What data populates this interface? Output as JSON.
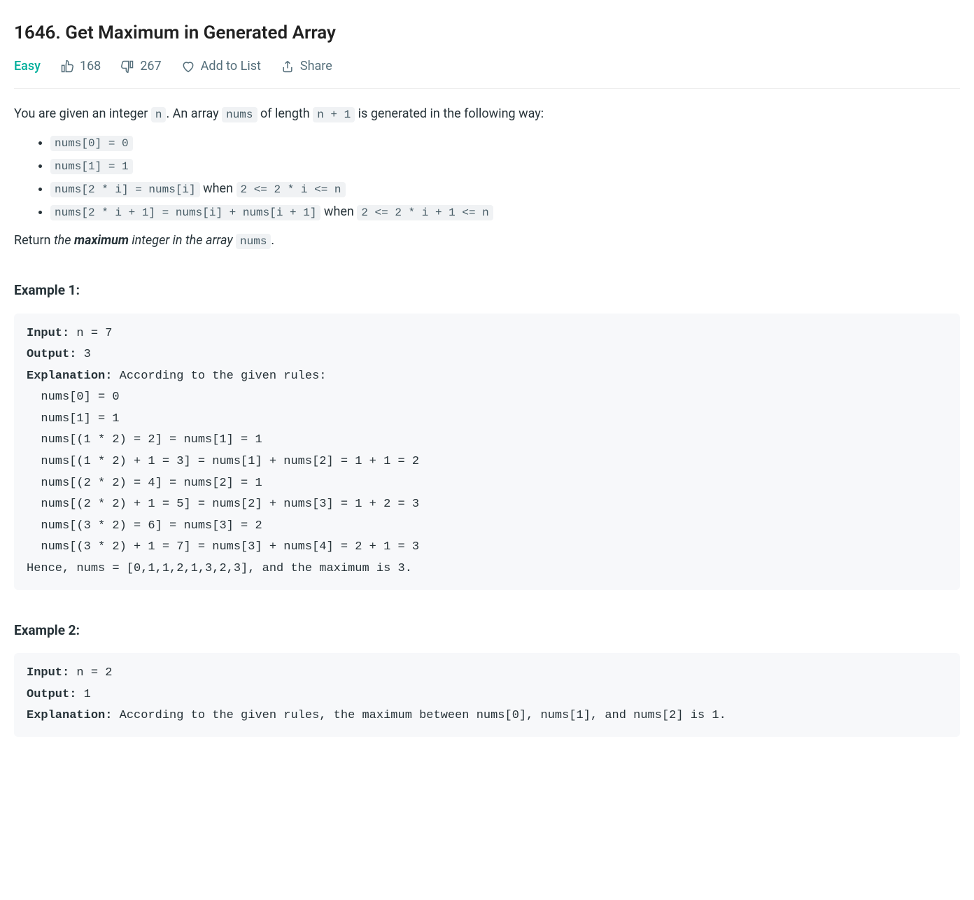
{
  "title": "1646. Get Maximum in Generated Array",
  "meta": {
    "difficulty": "Easy",
    "likes": "168",
    "dislikes": "267",
    "add_to_list": "Add to List",
    "share": "Share"
  },
  "intro": {
    "p1_prefix": "You are given an integer ",
    "p1_code1": "n",
    "p1_mid1": ". An array ",
    "p1_code2": "nums",
    "p1_mid2": " of length ",
    "p1_code3": "n + 1",
    "p1_suffix": " is generated in the following way:"
  },
  "rules": [
    {
      "code_a": "nums[0] = 0",
      "plain_a": "",
      "code_b": "",
      "plain_b": ""
    },
    {
      "code_a": "nums[1] = 1",
      "plain_a": "",
      "code_b": "",
      "plain_b": ""
    },
    {
      "code_a": "nums[2 * i] = nums[i]",
      "plain_a": " when ",
      "code_b": "2 <= 2 * i <= n",
      "plain_b": ""
    },
    {
      "code_a": "nums[2 * i + 1] = nums[i] + nums[i + 1]",
      "plain_a": " when ",
      "code_b": "2 <= 2 * i + 1 <= n",
      "plain_b": ""
    }
  ],
  "return": {
    "prefix": "Return ",
    "em_prefix": "the ",
    "strong": "maximum",
    "em_suffix": " integer in the array ",
    "code": "nums",
    "suffix": "."
  },
  "examples": [
    {
      "heading": "Example 1:",
      "input_label": "Input:",
      "input_val": " n = 7",
      "output_label": "Output:",
      "output_val": " 3",
      "explanation_label": "Explanation:",
      "explanation_body": " According to the given rules:\n  nums[0] = 0\n  nums[1] = 1\n  nums[(1 * 2) = 2] = nums[1] = 1\n  nums[(1 * 2) + 1 = 3] = nums[1] + nums[2] = 1 + 1 = 2\n  nums[(2 * 2) = 4] = nums[2] = 1\n  nums[(2 * 2) + 1 = 5] = nums[2] + nums[3] = 1 + 2 = 3\n  nums[(3 * 2) = 6] = nums[3] = 2\n  nums[(3 * 2) + 1 = 7] = nums[3] + nums[4] = 2 + 1 = 3\nHence, nums = [0,1,1,2,1,3,2,3], and the maximum is 3."
    },
    {
      "heading": "Example 2:",
      "input_label": "Input:",
      "input_val": " n = 2",
      "output_label": "Output:",
      "output_val": " 1",
      "explanation_label": "Explanation:",
      "explanation_body": " According to the given rules, the maximum between nums[0], nums[1], and nums[2] is 1."
    }
  ]
}
